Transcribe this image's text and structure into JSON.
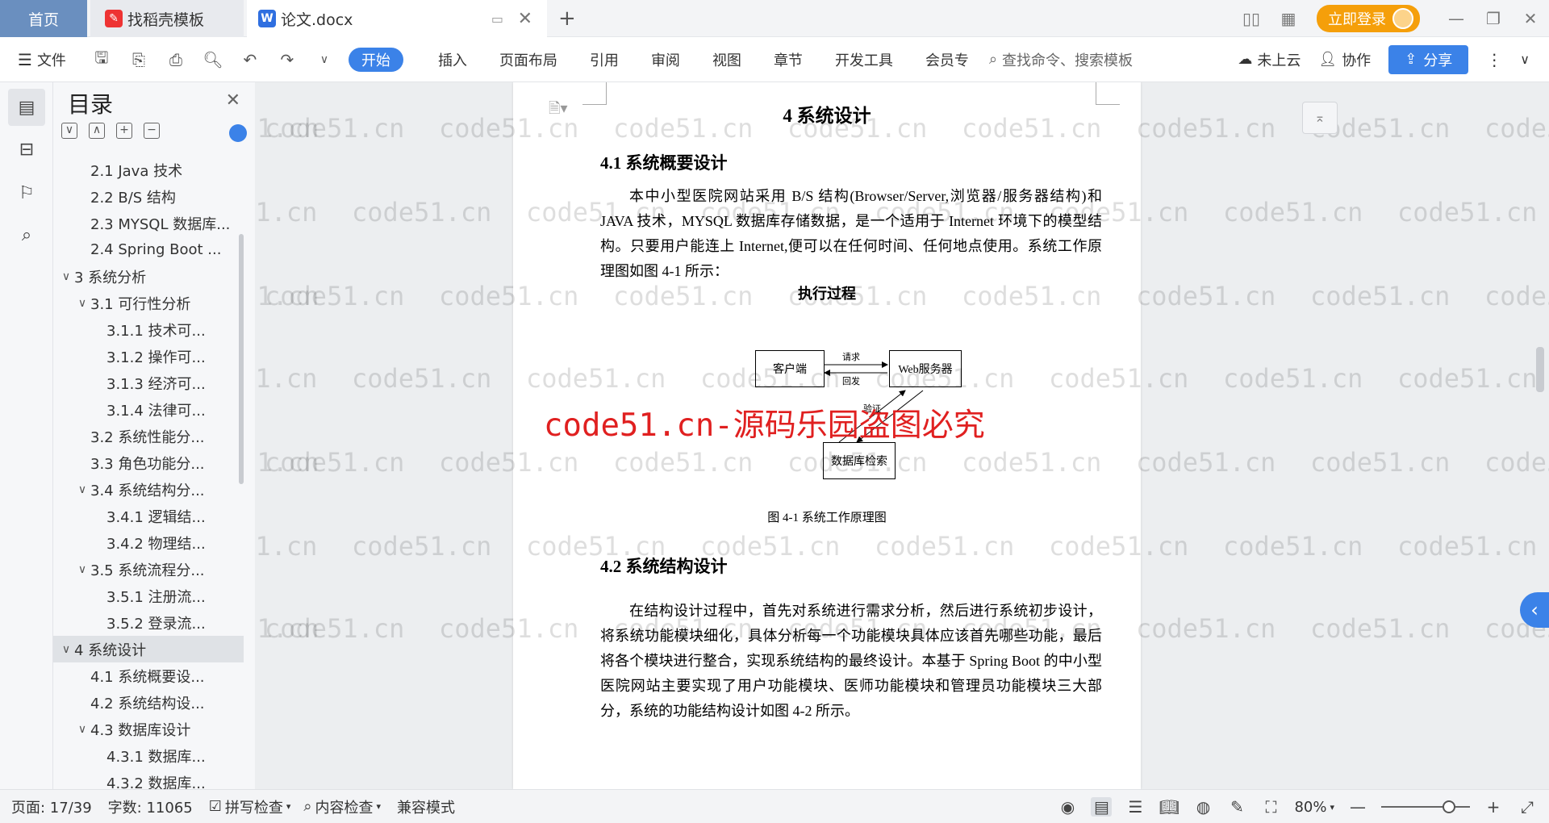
{
  "tabs": {
    "home": "首页",
    "template": "找稻壳模板",
    "doc": "论文.docx",
    "login": "立即登录"
  },
  "toolbar": {
    "file": "文件",
    "ribbon": [
      "开始",
      "插入",
      "页面布局",
      "引用",
      "审阅",
      "视图",
      "章节",
      "开发工具",
      "会员专"
    ],
    "search_placeholder": "查找命令、搜索模板",
    "cloud": "未上云",
    "collab": "协作",
    "share": "分享"
  },
  "toc": {
    "title": "目录",
    "items": [
      {
        "label": "2.1 Java 技术",
        "level": 2,
        "caret": ""
      },
      {
        "label": "2.2 B/S 结构",
        "level": 2,
        "caret": ""
      },
      {
        "label": "2.3 MYSQL 数据库...",
        "level": 2,
        "caret": ""
      },
      {
        "label": "2.4 Spring Boot ...",
        "level": 2,
        "caret": ""
      },
      {
        "label": "3 系统分析",
        "level": 1,
        "caret": "∨"
      },
      {
        "label": "3.1 可行性分析",
        "level": 2,
        "caret": "∨"
      },
      {
        "label": "3.1.1 技术可...",
        "level": 3,
        "caret": ""
      },
      {
        "label": "3.1.2 操作可...",
        "level": 3,
        "caret": ""
      },
      {
        "label": "3.1.3 经济可...",
        "level": 3,
        "caret": ""
      },
      {
        "label": "3.1.4 法律可...",
        "level": 3,
        "caret": ""
      },
      {
        "label": "3.2 系统性能分...",
        "level": 2,
        "caret": ""
      },
      {
        "label": "3.3 角色功能分...",
        "level": 2,
        "caret": ""
      },
      {
        "label": "3.4 系统结构分...",
        "level": 2,
        "caret": "∨"
      },
      {
        "label": "3.4.1 逻辑结...",
        "level": 3,
        "caret": ""
      },
      {
        "label": "3.4.2 物理结...",
        "level": 3,
        "caret": ""
      },
      {
        "label": "3.5 系统流程分...",
        "level": 2,
        "caret": "∨"
      },
      {
        "label": "3.5.1 注册流...",
        "level": 3,
        "caret": ""
      },
      {
        "label": "3.5.2 登录流...",
        "level": 3,
        "caret": ""
      },
      {
        "label": "4 系统设计",
        "level": 1,
        "caret": "∨",
        "selected": true
      },
      {
        "label": "4.1 系统概要设...",
        "level": 2,
        "caret": ""
      },
      {
        "label": "4.2 系统结构设...",
        "level": 2,
        "caret": ""
      },
      {
        "label": "4.3 数据库设计",
        "level": 2,
        "caret": "∨"
      },
      {
        "label": "4.3.1 数据库...",
        "level": 3,
        "caret": ""
      },
      {
        "label": "4.3.2 数据库...",
        "level": 3,
        "caret": ""
      }
    ]
  },
  "document": {
    "chapter": "4 系统设计",
    "sec1": "4.1 系统概要设计",
    "para1": "本中小型医院网站采用 B/S 结构(Browser/Server,浏览器/服务器结构)和 JAVA 技术，MYSQL 数据库存储数据，是一个适用于 Internet 环境下的模型结构。只要用户能连上 Internet,便可以在任何时间、任何地点使用。系统工作原理图如图 4-1 所示：",
    "fig_title": "执行过程",
    "fig_client": "客户端",
    "fig_server": "Web服务器",
    "fig_db": "数据库检索",
    "fig_req": "请求",
    "fig_resp": "回发",
    "fig_verify": "验证",
    "fig_caption": "图 4-1 系统工作原理图",
    "sec2": "4.2 系统结构设计",
    "para2": "在结构设计过程中，首先对系统进行需求分析，然后进行系统初步设计，将系统功能模块细化，具体分析每一个功能模块具体应该首先哪些功能，最后将各个模块进行整合，实现系统结构的最终设计。本基于 Spring Boot 的中小型医院网站主要实现了用户功能模块、医师功能模块和管理员功能模块三大部分，系统的功能结构设计如图 4-2 所示。"
  },
  "watermark": {
    "text": "code51.cn",
    "big": "code51.cn-源码乐园盗图必究"
  },
  "status": {
    "page": "页面: 17/39",
    "words": "字数: 11065",
    "spell": "拼写检查",
    "content": "内容检查",
    "compat": "兼容模式",
    "zoom": "80%"
  }
}
